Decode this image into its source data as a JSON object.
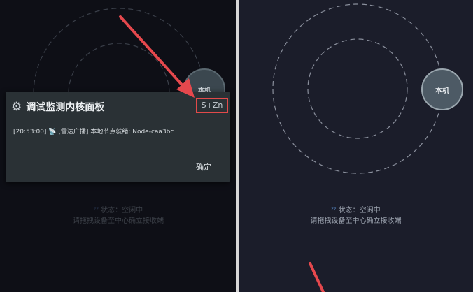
{
  "left": {
    "node_label": "本机",
    "status_text": "状态：空闲中",
    "hint_text": "请拖拽设备至中心确立接收端"
  },
  "right": {
    "node_label": "本机",
    "status_text": "状态：空闲中",
    "hint_text": "请拖拽设备至中心确立接收端"
  },
  "dialog": {
    "title": "调试监测内核面板",
    "shortcut": "S+Zn",
    "log_time": "[20:53:00]",
    "log_tag": "[雷达广播]",
    "log_message": "本地节点就绪: Node-caa3bc",
    "confirm_label": "确定"
  },
  "icons": {
    "title_icon": "gear-icon",
    "log_icon": "satellite-icon",
    "status_icon": "sleep-icon"
  },
  "colors": {
    "highlight": "#e24a4a",
    "dialog_bg": "#2a3135",
    "right_bg": "#1b1d2a"
  }
}
